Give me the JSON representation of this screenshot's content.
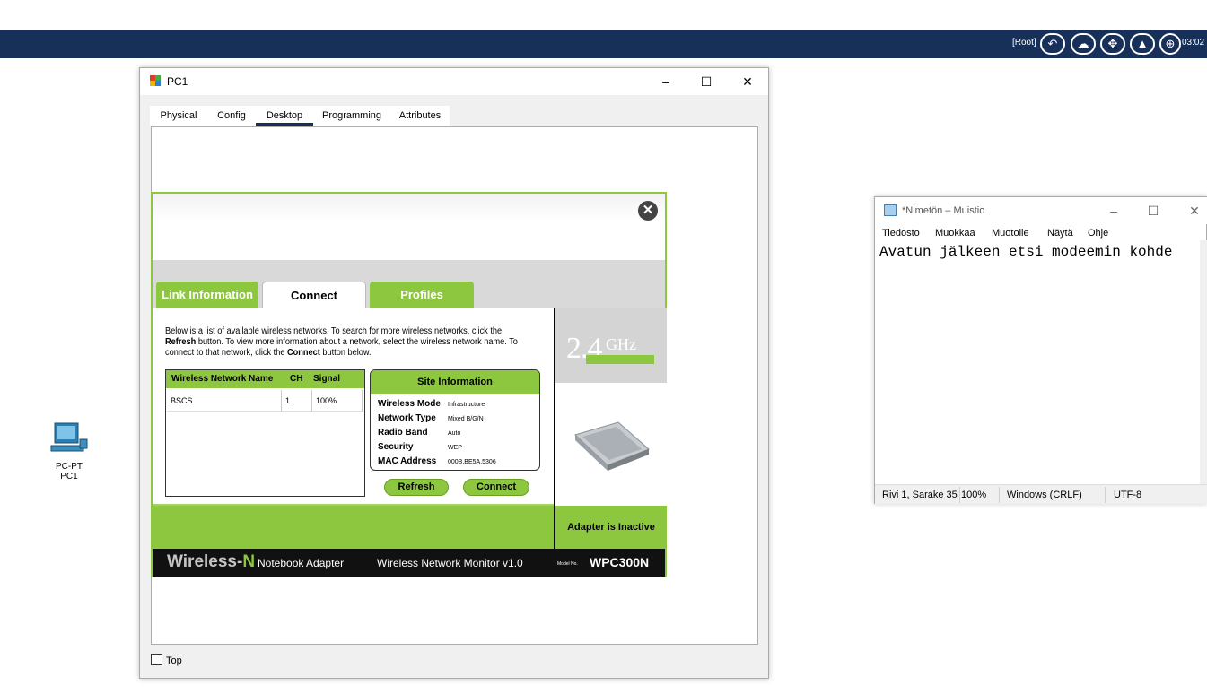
{
  "topbar": {
    "root_label": "[Root]",
    "clock": "03:02",
    "icons": [
      "back-arrow-icon",
      "cloud-icon",
      "move-icon",
      "landscape-icon",
      "network-icon"
    ]
  },
  "desktop": {
    "pc_icon": {
      "type_label": "PC-PT",
      "name_label": "PC1"
    }
  },
  "pc1_window": {
    "title": "PC1",
    "tabs": [
      "Physical",
      "Config",
      "Desktop",
      "Programming",
      "Attributes"
    ],
    "active_tab": "Desktop",
    "top_checkbox_label": "Top",
    "controls": {
      "minimize": "–",
      "maximize": "☐",
      "close": "✕"
    }
  },
  "monitor": {
    "tabs": [
      "Link Information",
      "Connect",
      "Profiles"
    ],
    "active_tab": "Connect",
    "desc_part1": "Below is a list of available wireless networks. To search for more wireless networks, click the ",
    "desc_refresh": "Refresh",
    "desc_part2": " button. To view more information about a network, select the wireless network name. To connect to that network, click the ",
    "desc_connect": "Connect",
    "desc_part3": " button below.",
    "list": {
      "headers": [
        "Wireless Network Name",
        "CH",
        "Signal"
      ],
      "rows": [
        {
          "name": "BSCS",
          "ch": "1",
          "signal": "100%"
        }
      ]
    },
    "site_info": {
      "title": "Site Information",
      "rows": [
        {
          "key": "Wireless Mode",
          "value": "Infrastructure"
        },
        {
          "key": "Network Type",
          "value": "Mixed B/G/N"
        },
        {
          "key": "Radio Band",
          "value": "Auto"
        },
        {
          "key": "Security",
          "value": "WEP"
        },
        {
          "key": "MAC Address",
          "value": "000B.BE5A.5306"
        }
      ]
    },
    "buttons": {
      "refresh": "Refresh",
      "connect": "Connect"
    },
    "ghz_big": "2.4",
    "ghz_unit": "GHz",
    "adapter_status": "Adapter is Inactive",
    "footer": {
      "brand_a": "Wireless-",
      "brand_b": "N",
      "product": "Notebook Adapter",
      "app_name": "Wireless Network Monitor  v1.0",
      "model_prefix": "Model No.",
      "model": "WPC300N"
    },
    "accent_color": "#8dc63f"
  },
  "notepad": {
    "title": "*Nimetön – Muistio",
    "menu": [
      "Tiedosto",
      "Muokkaa",
      "Muotoile",
      "Näytä",
      "Ohje"
    ],
    "content": "Avatun jälkeen etsi modeemin kohde",
    "status": {
      "position": "Rivi 1, Sarake 35",
      "zoom": "100%",
      "line_endings": "Windows (CRLF)",
      "encoding": "UTF-8"
    },
    "controls": {
      "minimize": "–",
      "maximize": "☐",
      "close": "✕"
    }
  }
}
